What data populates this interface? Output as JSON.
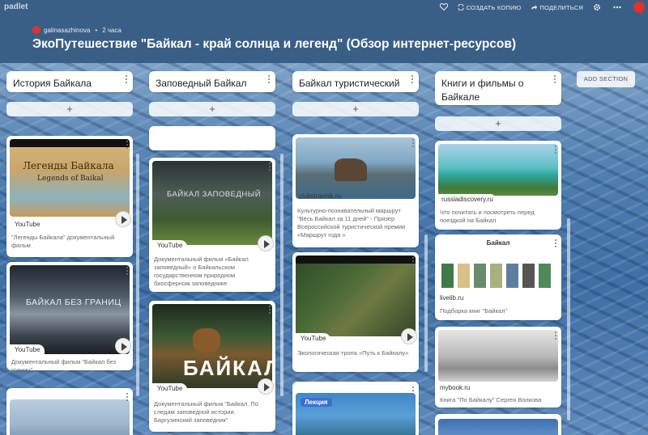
{
  "app": {
    "logo": "padlet"
  },
  "header": {
    "author": "galinasazhinova",
    "time_ago": "2 часа",
    "title": "ЭкоПутешествие \"Байкал - край солнца и легенд\" (Обзор интернет-ресурсов)",
    "actions": {
      "remake": "СОЗДАТЬ КОПИЮ",
      "share": "ПОДЕЛИТЬСЯ"
    }
  },
  "add_section": "ADD SECTION",
  "columns": [
    {
      "title": "История Байкала",
      "cards": [
        {
          "source": "YouTube",
          "caption": "\"Легенды Байкала\" документальный фильм",
          "thumb_text": "Легенды Байкала"
        },
        {
          "source": "YouTube",
          "caption": "Документальный фильм \"Байкал без границ\"",
          "thumb_text": "БАЙКАЛ БЕЗ ГРАНИЦ"
        },
        {
          "source": "",
          "caption": "",
          "thumb_text": ""
        }
      ]
    },
    {
      "title": "Заповедный Байкал",
      "cards": [
        {
          "source": "YouTube",
          "caption": "Документальный фильм «Байкал заповедный» о Байкальском государственном природном биосферном заповеднике",
          "thumb_text": "БАЙКАЛ ЗАПОВЕДНЫЙ"
        },
        {
          "source": "YouTube",
          "caption": "Документальный фильм \"Байкал. По следам заповедной истории. Баргузинский заповедник\"",
          "thumb_text": "БАЙКАЛ"
        }
      ]
    },
    {
      "title": "Байкал туристический",
      "cards": [
        {
          "source": "clubstrannik.ru",
          "caption": "Культурно-познавательный маршрут \"Весь Байкал за 11 дней\" - Призер Всероссийской туристической премии «Маршрут года »"
        },
        {
          "source": "YouTube",
          "caption": "Экологическая тропа «Путь к Байкалу»"
        },
        {
          "source": "",
          "caption": "",
          "thumb_text": "Лекция"
        }
      ]
    },
    {
      "title": "Книги и фильмы о Байкале",
      "cards": [
        {
          "source": "russiadiscovery.ru",
          "caption": "Что почитать и посмотреть перед поездкой на Байкал"
        },
        {
          "source": "livelib.ru",
          "caption": "Подборка книг \"Байкал\"",
          "thumb_text": "Байкал"
        },
        {
          "source": "mybook.ru",
          "caption": "Книга \"По Байкалу\" Сергея Волкова"
        }
      ]
    }
  ],
  "colors": {
    "header": "#3a5f86",
    "card": "#ffffff",
    "accent": "#e0312a"
  }
}
